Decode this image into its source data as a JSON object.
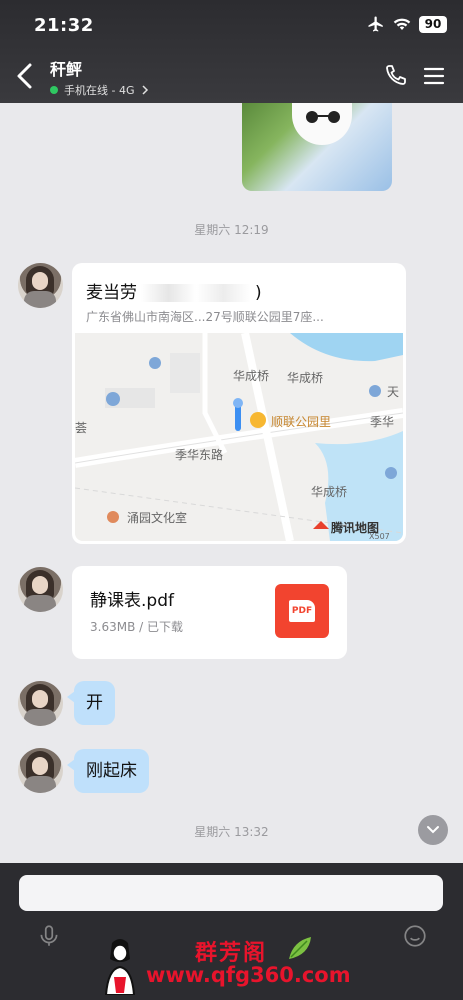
{
  "status_bar": {
    "time": "21:32",
    "battery": "90"
  },
  "header": {
    "chat_name": "秆鲆",
    "online_status": "手机在线 - 4G"
  },
  "chat": {
    "time_divider_1": "星期六 12:19",
    "location": {
      "title": "麦当劳",
      "title_suffix": ")",
      "address": "广东省佛山市南海区...27号顺联公园里7座...",
      "map": {
        "labels": [
          "华成桥",
          "华成桥",
          "顺联公园里",
          "季华东路",
          "季华",
          "华成桥",
          "涌园文化室",
          "荟",
          "天",
          "腾讯地图",
          "X507"
        ]
      }
    },
    "file": {
      "name": "静课表.pdf",
      "meta": "3.63MB / 已下载",
      "icon_label": "PDF"
    },
    "messages": [
      {
        "text": "开"
      },
      {
        "text": "刚起床"
      }
    ],
    "time_divider_2": "星期六 13:32"
  },
  "input": {
    "placeholder": ""
  },
  "watermark": {
    "title": "群芳阁",
    "url": "www.qfg360.com"
  },
  "colors": {
    "header_bg": "#2c2c30",
    "chat_bg": "#e9e9ec",
    "bubble": "#bfe0fb",
    "pdf": "#f2442f",
    "online": "#2fc862"
  }
}
